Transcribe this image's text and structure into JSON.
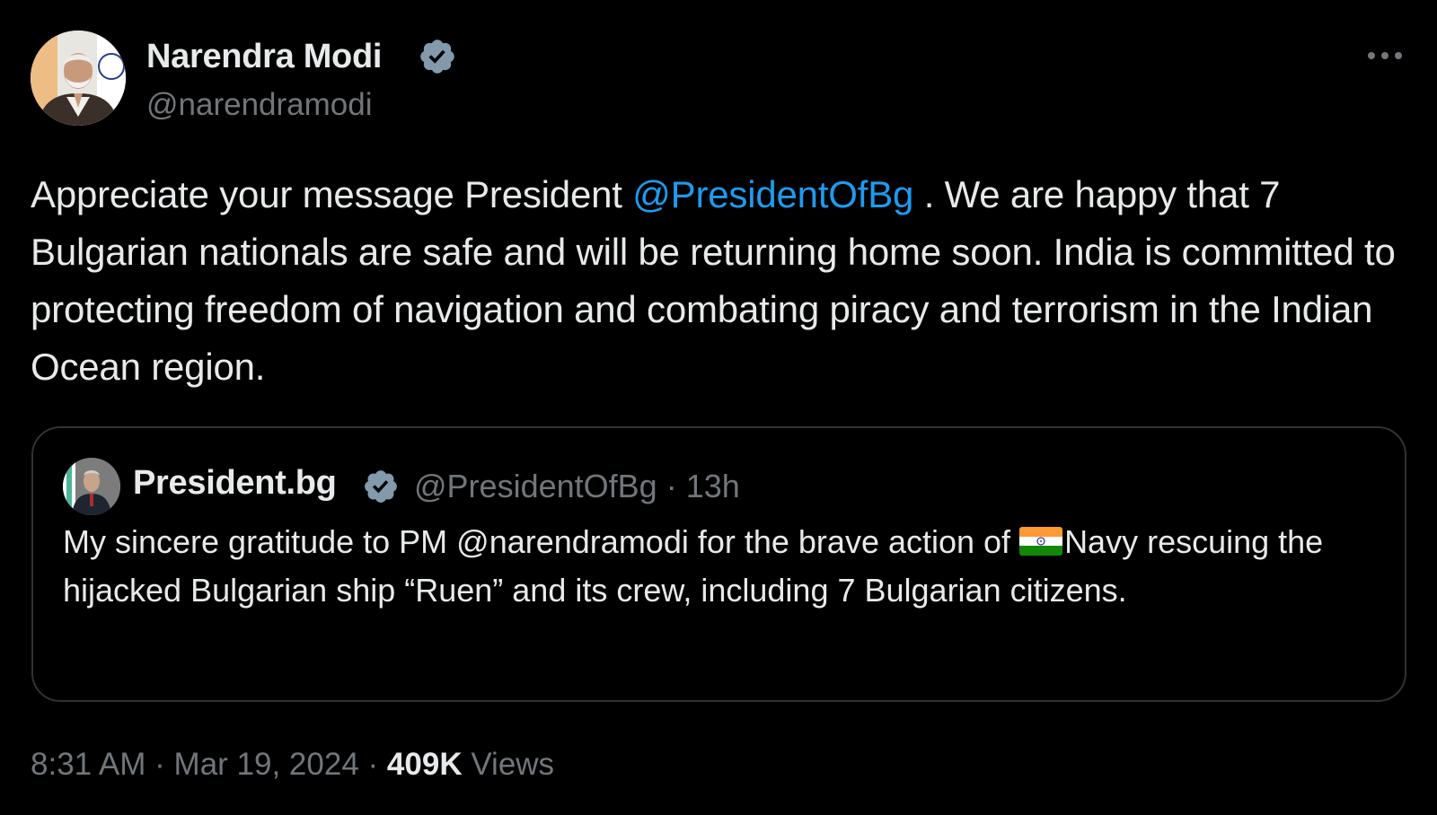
{
  "tweet": {
    "author": {
      "name": "Narendra Modi",
      "handle": "@narendramodi",
      "verified": true
    },
    "text": {
      "before_mention": "Appreciate your message President ",
      "mention": "@PresidentOfBg",
      "after_mention": " . We are happy that 7 Bulgarian nationals are safe and will be returning home soon. India is committed to protecting freedom of navigation and combating piracy and terrorism in the Indian Ocean region."
    },
    "more_icon": "more-horizontal-icon",
    "time": "8:31 AM",
    "date": "Mar 19, 2024",
    "separator": "·",
    "views_count": "409K",
    "views_label": "Views"
  },
  "quote": {
    "author": {
      "name": "President.bg",
      "handle": "@PresidentOfBg",
      "verified": true
    },
    "separator": "·",
    "age": "13h",
    "text_before_flag": "My sincere gratitude to PM @narendramodi for the brave action of ",
    "flag_icon": "india-flag-icon",
    "text_after_flag": "Navy rescuing the hijacked Bulgarian ship “Ruen” and its crew, including 7 Bulgarian citizens."
  },
  "colors": {
    "background": "#000000",
    "text_primary": "#e7e9ea",
    "text_secondary": "#71767b",
    "accent_link": "#1d9bf0",
    "border": "#2f3336",
    "verified_badge": "#829aab"
  }
}
